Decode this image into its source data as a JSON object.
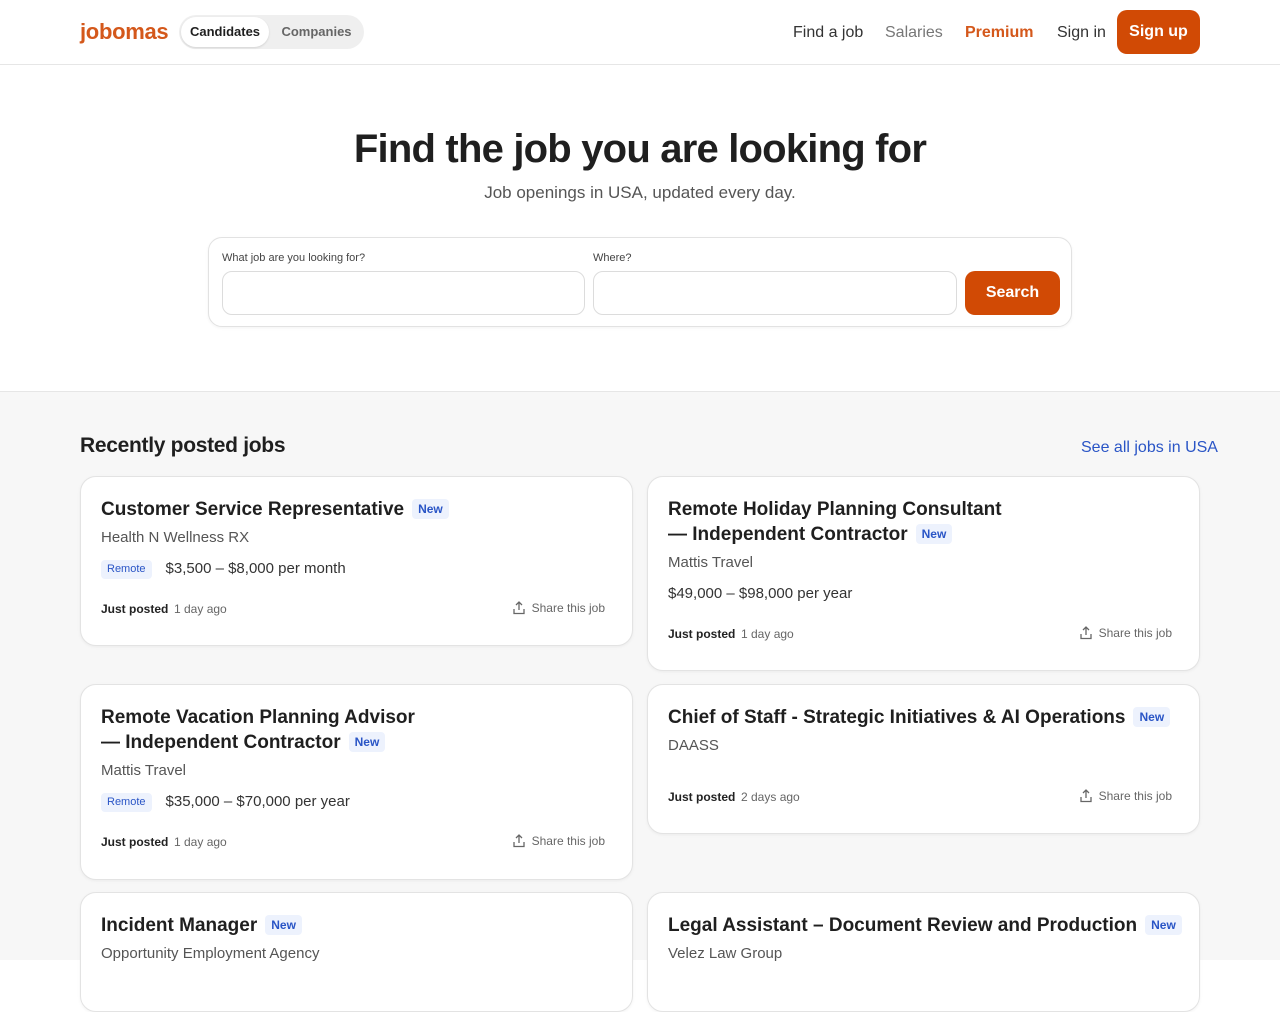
{
  "header": {
    "logo": "jobomas",
    "toggle": {
      "active": "Candidates",
      "inactive": "Companies"
    },
    "nav": {
      "find_job": "Find a job",
      "salaries": "Salaries",
      "premium": "Premium",
      "sign_in": "Sign in"
    },
    "sign_up": "Sign up",
    "colors": {
      "brand": "#d14a05",
      "link": "#2a55c6"
    }
  },
  "hero": {
    "title": "Find the job you are looking for",
    "subtitle": "Job openings in USA, updated every day.",
    "search": {
      "what_label": "What job are you looking for?",
      "what_value": "",
      "where_label": "Where?",
      "where_value": "",
      "button": "Search"
    }
  },
  "listing": {
    "heading": "Recently posted jobs",
    "see_all": "See all jobs in USA",
    "new_label": "New",
    "remote_label": "Remote",
    "posted_label": "Just posted",
    "share_label": "Share this job",
    "jobs": [
      {
        "title": "Customer Service Representative",
        "company": "Health N Wellness RX",
        "remote": true,
        "salary": "$3,500 – $8,000 per month",
        "ago": "1 day ago"
      },
      {
        "title_line1": "Remote Holiday Planning Consultant",
        "title_line2": "— Independent Contractor",
        "company": "Mattis Travel",
        "remote": false,
        "salary": "$49,000 – $98,000 per year",
        "ago": "1 day ago"
      },
      {
        "title_line1": "Remote Vacation Planning Advisor",
        "title_line2": "— Independent Contractor",
        "company": "Mattis Travel",
        "remote": true,
        "salary": "$35,000 – $70,000 per year",
        "ago": "1 day ago"
      },
      {
        "title": "Chief of Staff - Strategic Initiatives & AI Operations",
        "company": "DAASS",
        "remote": false,
        "salary": "",
        "ago": "2 days ago"
      },
      {
        "title": "Incident Manager",
        "company": "Opportunity Employment Agency"
      },
      {
        "title": "Legal Assistant – Document Review and Production",
        "company": "Velez Law Group"
      }
    ]
  }
}
